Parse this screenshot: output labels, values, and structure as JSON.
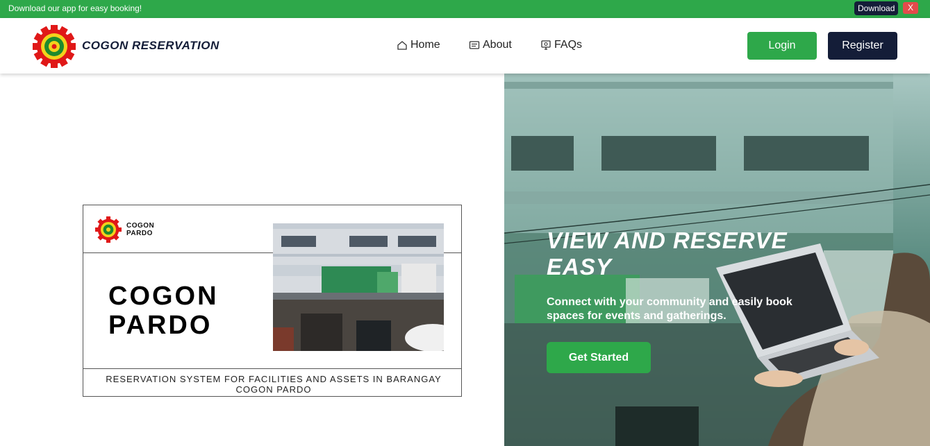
{
  "banner": {
    "text": "Download our app for easy booking!",
    "download_label": "Download",
    "close_label": "X"
  },
  "navbar": {
    "brand": "COGON RESERVATION",
    "links": [
      {
        "label": "Home",
        "icon": "home-icon"
      },
      {
        "label": "About",
        "icon": "about-icon"
      },
      {
        "label": "FAQs",
        "icon": "faqs-icon"
      }
    ],
    "login_label": "Login",
    "register_label": "Register"
  },
  "card": {
    "logo_text": "COGON PARDO",
    "title": "COGON PARDO",
    "footer": "RESERVATION SYSTEM FOR FACILITIES AND ASSETS IN BARANGAY COGON PARDO"
  },
  "hero": {
    "title": "VIEW AND RESERVE EASY",
    "subtitle": "Connect with your community and easily book spaces for events and gatherings.",
    "cta_label": "Get Started"
  },
  "colors": {
    "green": "#2ea84a",
    "navy": "#141d38",
    "red": "#e34b4b"
  }
}
